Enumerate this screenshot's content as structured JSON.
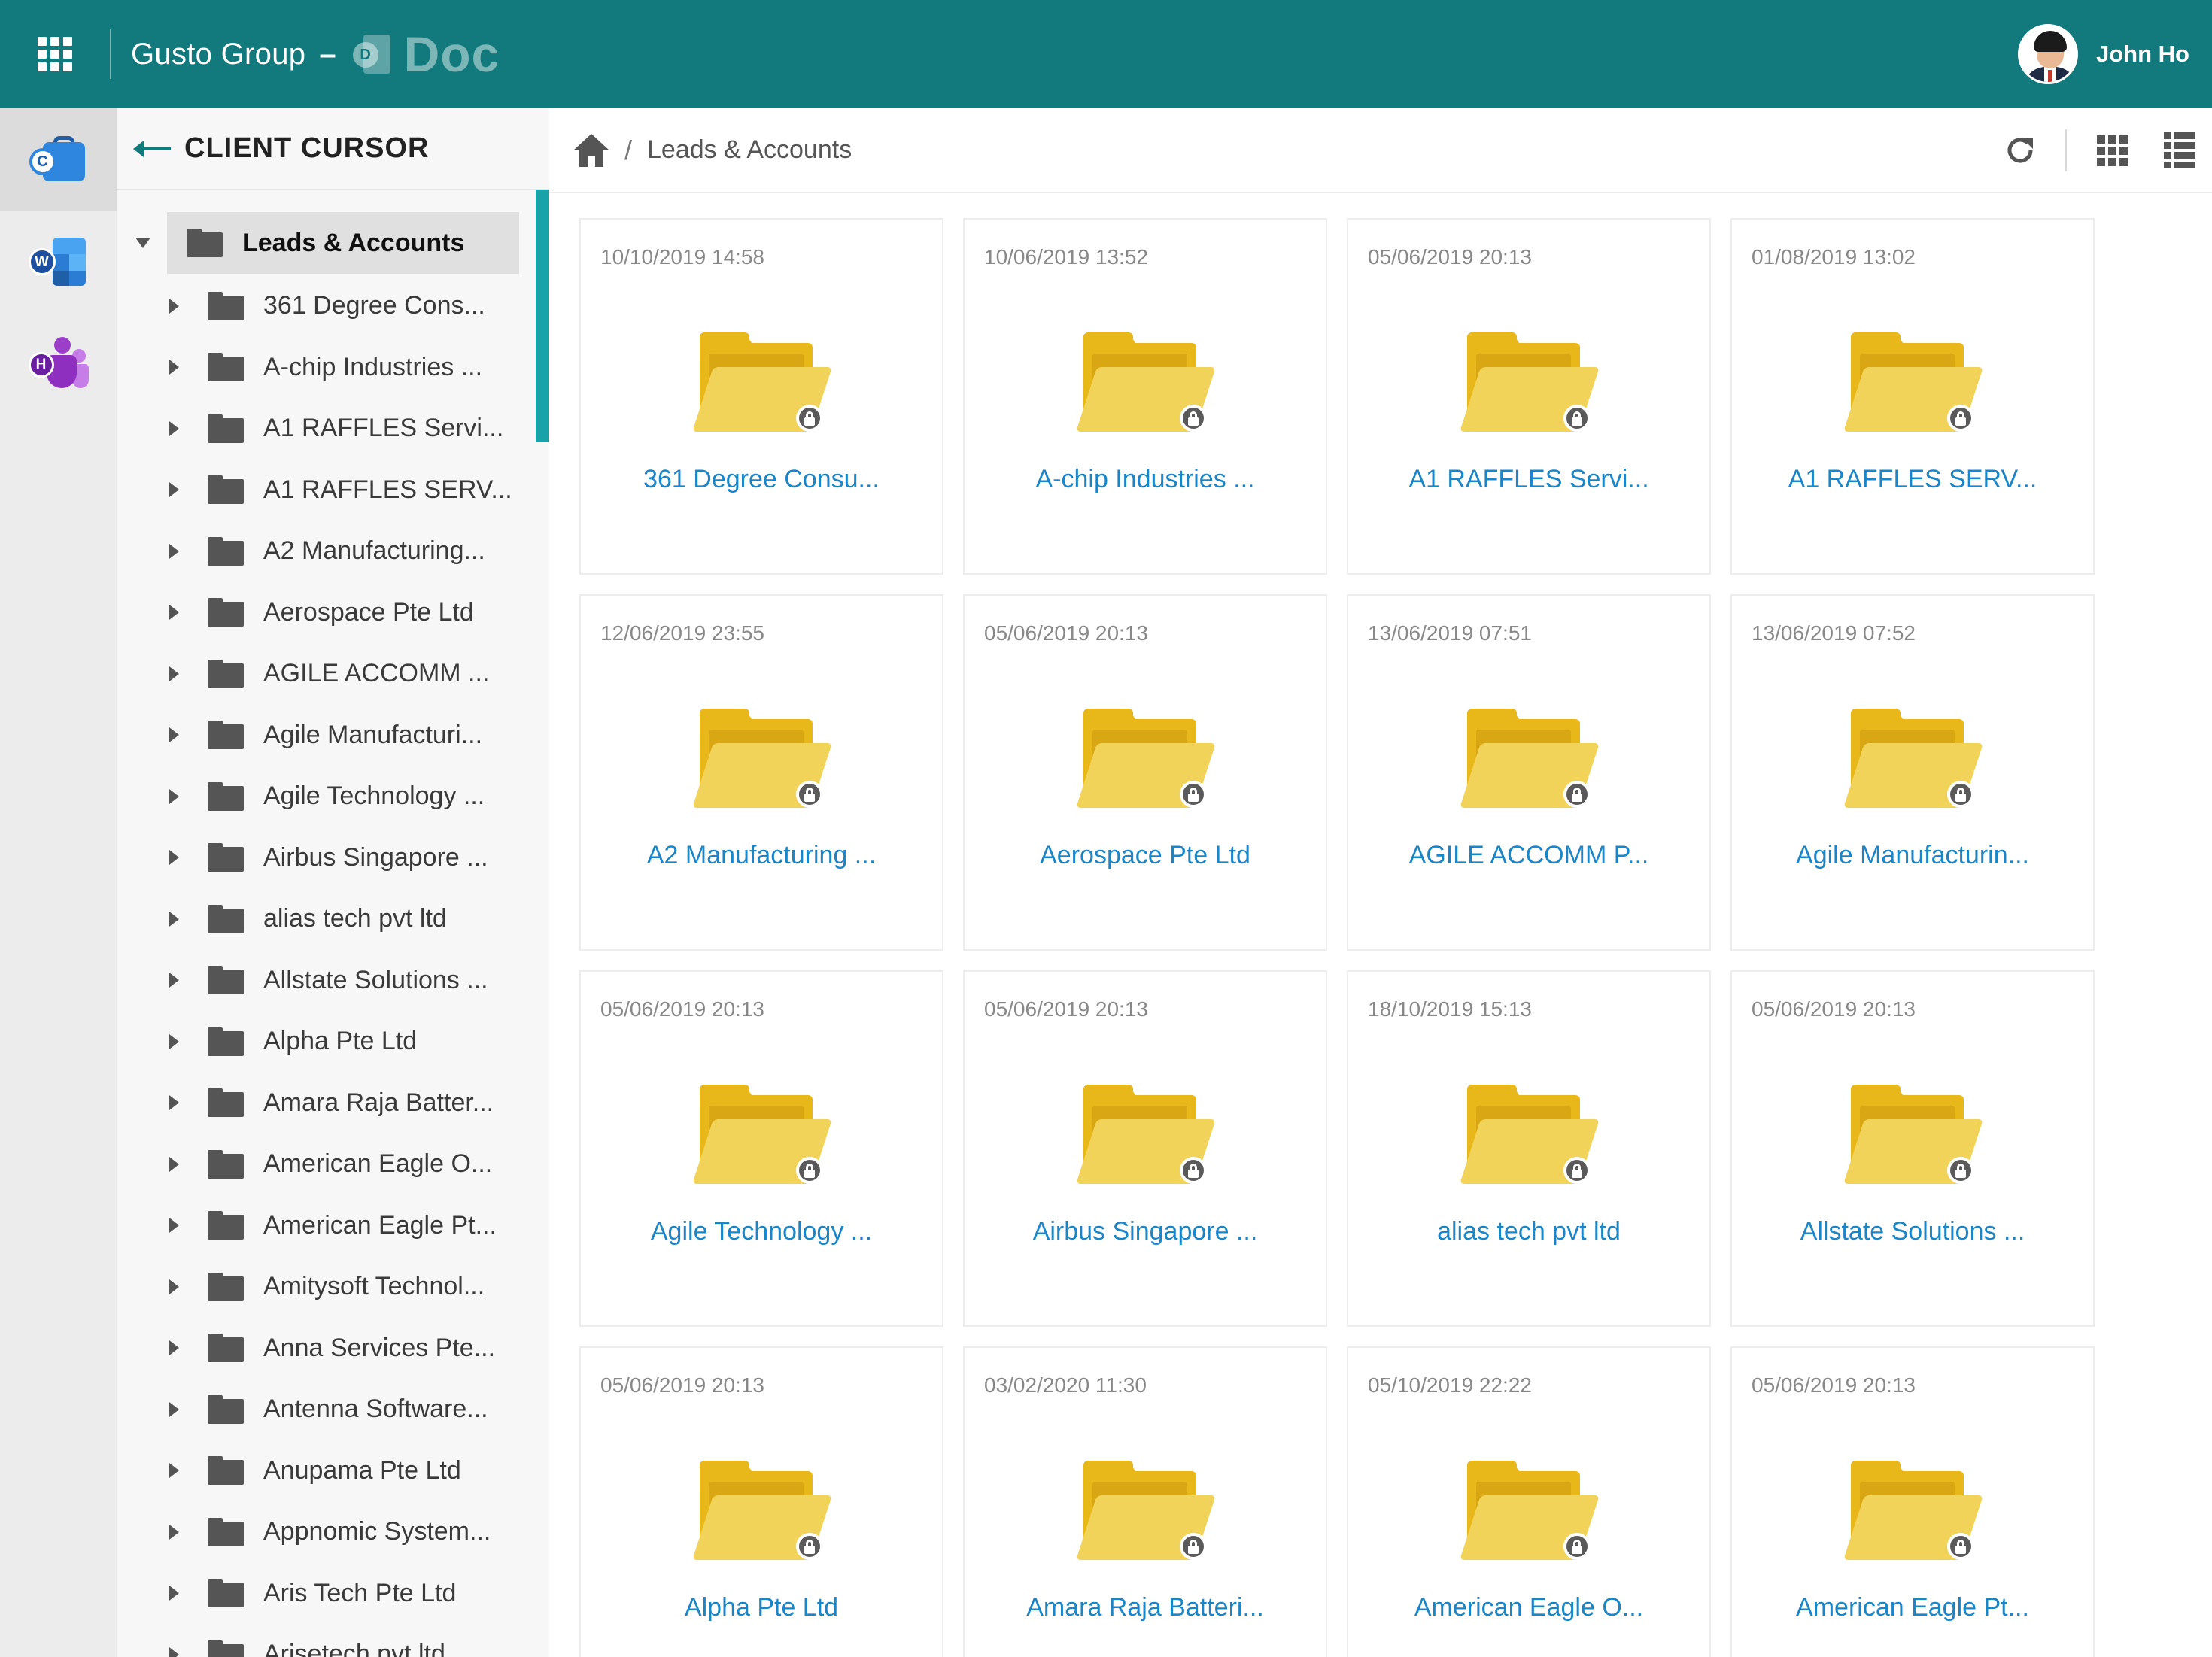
{
  "header": {
    "org_name": "Gusto Group",
    "separator": "–",
    "app_badge_letter": "D",
    "app_name": "Doc",
    "user_name": "John Ho",
    "brand_color": "#127a7c"
  },
  "rail": {
    "items": [
      {
        "icon": "client-cursor-app-icon",
        "letter": "C",
        "active": true
      },
      {
        "icon": "word-doc-app-icon",
        "letter": "W",
        "active": false
      },
      {
        "icon": "hr-teams-app-icon",
        "letter": "H",
        "active": false
      }
    ]
  },
  "tree": {
    "title": "CLIENT CURSOR",
    "root": "Leads & Accounts",
    "items": [
      "361 Degree Cons...",
      "A-chip Industries ...",
      "A1 RAFFLES Servi...",
      "A1 RAFFLES SERV...",
      "A2 Manufacturing...",
      "Aerospace Pte Ltd",
      "AGILE ACCOMM ...",
      "Agile Manufacturi...",
      "Agile Technology ...",
      "Airbus Singapore ...",
      "alias tech pvt ltd",
      "Allstate Solutions ...",
      "Alpha Pte Ltd",
      "Amara Raja Batter...",
      "American Eagle O...",
      "American Eagle Pt...",
      "Amitysoft Technol...",
      "Anna Services Pte...",
      "Antenna Software...",
      "Anupama Pte Ltd",
      "Appnomic System...",
      "Aris Tech Pte Ltd",
      "Arisetech pvt ltd"
    ]
  },
  "breadcrumb": {
    "separator": "/",
    "current": "Leads & Accounts"
  },
  "cards": [
    {
      "date": "10/10/2019 14:58",
      "name": "361 Degree Consu..."
    },
    {
      "date": "10/06/2019 13:52",
      "name": "A-chip Industries ..."
    },
    {
      "date": "05/06/2019 20:13",
      "name": "A1 RAFFLES Servi..."
    },
    {
      "date": "01/08/2019 13:02",
      "name": "A1 RAFFLES SERV..."
    },
    {
      "date": "12/06/2019 23:55",
      "name": "A2 Manufacturing ..."
    },
    {
      "date": "05/06/2019 20:13",
      "name": "Aerospace Pte Ltd"
    },
    {
      "date": "13/06/2019 07:51",
      "name": "AGILE ACCOMM P..."
    },
    {
      "date": "13/06/2019 07:52",
      "name": "Agile Manufacturin..."
    },
    {
      "date": "05/06/2019 20:13",
      "name": "Agile Technology ..."
    },
    {
      "date": "05/06/2019 20:13",
      "name": "Airbus Singapore ..."
    },
    {
      "date": "18/10/2019 15:13",
      "name": "alias tech pvt ltd"
    },
    {
      "date": "05/06/2019 20:13",
      "name": "Allstate Solutions ..."
    },
    {
      "date": "05/06/2019 20:13",
      "name": "Alpha Pte Ltd"
    },
    {
      "date": "03/02/2020 11:30",
      "name": "Amara Raja Batteri..."
    },
    {
      "date": "05/10/2019 22:22",
      "name": "American Eagle O..."
    },
    {
      "date": "05/06/2019 20:13",
      "name": "American Eagle Pt..."
    }
  ]
}
